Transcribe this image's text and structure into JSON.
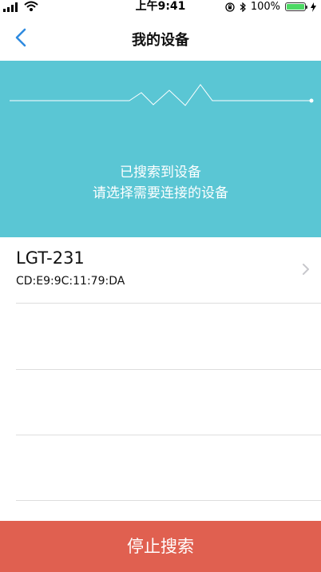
{
  "status_bar": {
    "time": "上午9:41",
    "battery_percent": "100%",
    "battery_level": 1.0,
    "icons": [
      "signal-icon",
      "wifi-icon",
      "orientation-lock-icon",
      "bluetooth-icon",
      "battery-icon",
      "charging-icon"
    ]
  },
  "nav": {
    "title": "我的设备",
    "back_icon": "chevron-left-icon"
  },
  "banner": {
    "line1": "已搜索到设备",
    "line2": "请选择需要连接的设备",
    "color": "#5ac6d4"
  },
  "devices": [
    {
      "name": "LGT-231",
      "mac": "CD:E9:9C:11:79:DA"
    }
  ],
  "footer": {
    "stop_label": "停止搜索",
    "color": "#e06050"
  },
  "colors": {
    "accent": "#2f8be0",
    "banner": "#5ac6d4",
    "stop": "#e06050"
  }
}
